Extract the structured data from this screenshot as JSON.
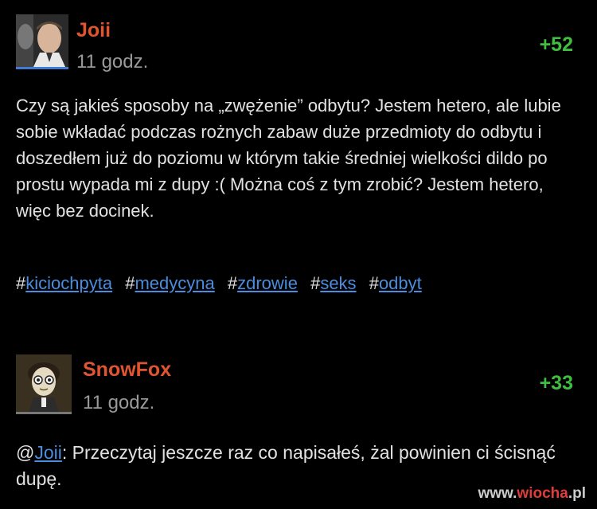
{
  "posts": [
    {
      "username": "Joii",
      "time": "11 godz.",
      "score": "+52",
      "body": "Czy są jakieś sposoby na „zwężenie” odbytu? Jestem hetero, ale lubie sobie wkładać podczas rożnych zabaw duże przedmioty do odbytu i doszedłem już do poziomu w którym takie średniej wielkości dildo po prostu wypada mi z dupy :( Można coś z tym zrobić? Jestem hetero, więc bez docinek.",
      "tags": [
        "kiciochpyta",
        "medycyna",
        "zdrowie",
        "seks",
        "odbyt"
      ]
    },
    {
      "username": "SnowFox",
      "time": "11 godz.",
      "score": "+33",
      "mention": "Joii",
      "body": ": Przeczytaj jeszcze raz co napisałeś, żal powinien ci ścisnąć dupę."
    }
  ],
  "watermark": {
    "prefix": "www.",
    "accent": "wiocha",
    "suffix": ".pl"
  },
  "colors": {
    "background": "#000000",
    "username": "#e0542f",
    "score": "#3fbf3f",
    "link": "#4a8dde"
  }
}
